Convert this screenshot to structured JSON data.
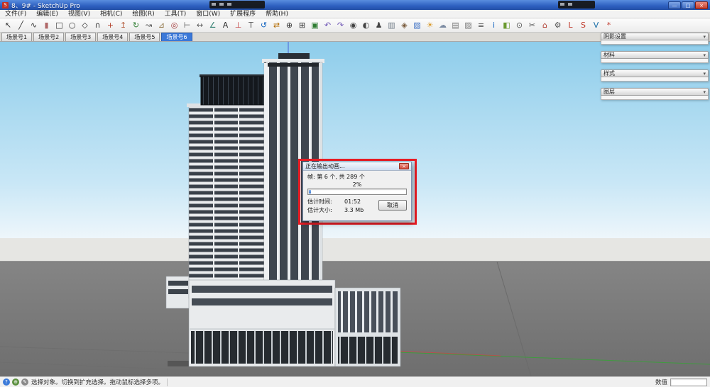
{
  "window": {
    "title": "8、9# - SketchUp Pro",
    "app_badge": "S",
    "controls": {
      "minimize": "—",
      "maximize": "□",
      "close": "×"
    }
  },
  "menu": {
    "items": [
      {
        "label": "文件(F)",
        "name": "menu-file"
      },
      {
        "label": "编辑(E)",
        "name": "menu-edit"
      },
      {
        "label": "视图(V)",
        "name": "menu-view"
      },
      {
        "label": "相机(C)",
        "name": "menu-camera"
      },
      {
        "label": "绘图(R)",
        "name": "menu-draw"
      },
      {
        "label": "工具(T)",
        "name": "menu-tools"
      },
      {
        "label": "窗口(W)",
        "name": "menu-window"
      },
      {
        "label": "扩展程序",
        "name": "menu-extensions"
      },
      {
        "label": "帮助(H)",
        "name": "menu-help"
      }
    ]
  },
  "toolbar": {
    "icons": [
      {
        "name": "select-tool-icon",
        "glyph": "↖",
        "color": "#333333"
      },
      {
        "name": "line-tool-icon",
        "glyph": "╱",
        "color": "#333333"
      },
      {
        "name": "freehand-tool-icon",
        "glyph": "∿",
        "color": "#333333"
      },
      {
        "name": "eraser-tool-icon",
        "glyph": "▮",
        "color": "#b06868"
      },
      {
        "name": "rectangle-tool-icon",
        "glyph": "□",
        "color": "#333333"
      },
      {
        "name": "circle-tool-icon",
        "glyph": "○",
        "color": "#333333"
      },
      {
        "name": "polygon-tool-icon",
        "glyph": "◇",
        "color": "#333333"
      },
      {
        "name": "arc-tool-icon",
        "glyph": "∩",
        "color": "#333333"
      },
      {
        "name": "move-tool-icon",
        "glyph": "+",
        "color": "#b3402a"
      },
      {
        "name": "push-pull-tool-icon",
        "glyph": "↥",
        "color": "#b3593a"
      },
      {
        "name": "rotate-tool-icon",
        "glyph": "↻",
        "color": "#2e7d32"
      },
      {
        "name": "follow-me-tool-icon",
        "glyph": "↝",
        "color": "#555555"
      },
      {
        "name": "scale-tool-icon",
        "glyph": "⊿",
        "color": "#8a6d3b"
      },
      {
        "name": "offset-tool-icon",
        "glyph": "◎",
        "color": "#a03333"
      },
      {
        "name": "tape-measure-tool-icon",
        "glyph": "⊢",
        "color": "#555555"
      },
      {
        "name": "dimension-tool-icon",
        "glyph": "↔",
        "color": "#555555"
      },
      {
        "name": "protractor-tool-icon",
        "glyph": "∠",
        "color": "#2e7d6f"
      },
      {
        "name": "text-tool-icon",
        "glyph": "A",
        "color": "#333333"
      },
      {
        "name": "axes-tool-icon",
        "glyph": "⊥",
        "color": "#c03333"
      },
      {
        "name": "3d-text-tool-icon",
        "glyph": "T",
        "color": "#555555"
      },
      {
        "name": "orbit-tool-icon",
        "glyph": "↺",
        "color": "#1565c0"
      },
      {
        "name": "pan-tool-icon",
        "glyph": "⇄",
        "color": "#b36b00"
      },
      {
        "name": "zoom-tool-icon",
        "glyph": "⊕",
        "color": "#333333"
      },
      {
        "name": "zoom-window-tool-icon",
        "glyph": "⊞",
        "color": "#333333"
      },
      {
        "name": "zoom-extents-tool-icon",
        "glyph": "▣",
        "color": "#2e7d32"
      },
      {
        "name": "previous-view-icon",
        "glyph": "↶",
        "color": "#6a4fb3"
      },
      {
        "name": "next-view-icon",
        "glyph": "↷",
        "color": "#6a4fb3"
      },
      {
        "name": "position-camera-icon",
        "glyph": "◉",
        "color": "#444444"
      },
      {
        "name": "look-around-icon",
        "glyph": "◐",
        "color": "#444444"
      },
      {
        "name": "walk-tool-icon",
        "glyph": "♟",
        "color": "#444444"
      },
      {
        "name": "section-plane-icon",
        "glyph": "▥",
        "color": "#6f7b86"
      },
      {
        "name": "make-component-icon",
        "glyph": "◈",
        "color": "#7a5c3e"
      },
      {
        "name": "paint-bucket-icon",
        "glyph": "▧",
        "color": "#3b6fc4"
      },
      {
        "name": "shadows-icon",
        "glyph": "☀",
        "color": "#d99a2b"
      },
      {
        "name": "fog-icon",
        "glyph": "☁",
        "color": "#7d8ca3"
      },
      {
        "name": "match-photo-icon",
        "glyph": "▤",
        "color": "#777777"
      },
      {
        "name": "styles-icon",
        "glyph": "▨",
        "color": "#777777"
      },
      {
        "name": "layers-icon",
        "glyph": "≡",
        "color": "#555555"
      },
      {
        "name": "entity-info-icon",
        "glyph": "i",
        "color": "#1565c0"
      },
      {
        "name": "materials-icon",
        "glyph": "◧",
        "color": "#6a9a2f"
      },
      {
        "name": "model-info-icon",
        "glyph": "⊙",
        "color": "#555555"
      },
      {
        "name": "purge-icon",
        "glyph": "✂",
        "color": "#555555"
      },
      {
        "name": "3d-warehouse-icon",
        "glyph": "⌂",
        "color": "#b03a2e"
      },
      {
        "name": "extension-warehouse-icon",
        "glyph": "⚙",
        "color": "#555555"
      },
      {
        "name": "layout-icon",
        "glyph": "L",
        "color": "#c0392b"
      },
      {
        "name": "style-builder-icon",
        "glyph": "S",
        "color": "#c0392b"
      },
      {
        "name": "vray-icon",
        "glyph": "V",
        "color": "#1a6fa8"
      },
      {
        "name": "plugin-icon",
        "glyph": "*",
        "color": "#c0392b"
      }
    ]
  },
  "scene_tabs": {
    "items": [
      {
        "label": "场景号1",
        "name": "scene-tab-1",
        "active": false
      },
      {
        "label": "场景号2",
        "name": "scene-tab-2",
        "active": false
      },
      {
        "label": "场景号3",
        "name": "scene-tab-3",
        "active": false
      },
      {
        "label": "场景号4",
        "name": "scene-tab-4",
        "active": false
      },
      {
        "label": "场景号5",
        "name": "scene-tab-5",
        "active": false
      },
      {
        "label": "场景号6",
        "name": "scene-tab-6",
        "active": true
      }
    ]
  },
  "tray_panels": {
    "toggle_glyph": "▾",
    "items": [
      {
        "title": "阴影设置",
        "name": "tray-panel-shadow-settings"
      },
      {
        "title": "材料",
        "name": "tray-panel-materials"
      },
      {
        "title": "样式",
        "name": "tray-panel-styles"
      },
      {
        "title": "图层",
        "name": "tray-panel-layers"
      }
    ]
  },
  "export_dialog": {
    "title": "正在输出动画...",
    "close_glyph": "×",
    "frame_line": "帧: 第 6 个, 共 289 个",
    "percent": "2%",
    "progress_value": 2,
    "time_label": "估计时间:",
    "time_value": "01:52",
    "size_label": "估计大小:",
    "size_value": "3.3 Mb",
    "cancel_label": "取消"
  },
  "status_bar": {
    "icons": [
      {
        "name": "status-help-icon",
        "glyph": "?",
        "bg": "#3b7ad9"
      },
      {
        "name": "status-geolocation-icon",
        "glyph": "⊕",
        "bg": "#5a8f3d"
      },
      {
        "name": "status-credits-icon",
        "glyph": "✎",
        "bg": "#8a8a8a"
      }
    ],
    "hint": "选择对象。切换到扩充选择。拖动鼠标选择多项。",
    "value_label": "数值",
    "value_text": ""
  },
  "colors": {
    "accent_blue": "#3b78d8",
    "highlight_red": "#ec1c24",
    "sky_top": "#8ecdeb",
    "fog_band": "#e6e6e3",
    "ground": "#7c7c7c",
    "axis_green": "#3f9b3f",
    "axis_red": "#cc4444",
    "axis_blue": "#4a63d8"
  }
}
